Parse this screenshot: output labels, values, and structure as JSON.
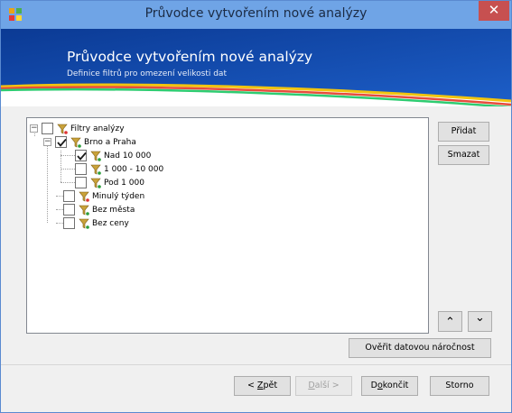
{
  "window": {
    "title": "Průvodce vytvořením nové analýzy",
    "close_glyph": "✕",
    "titlebar_color": "#6fa4e6",
    "close_color": "#c75050"
  },
  "banner": {
    "title": "Průvodce vytvořením nové analýzy",
    "subtitle": "Definice filtrů pro omezení velikosti dat",
    "background": "#0a3d9e"
  },
  "tree": {
    "root": {
      "label": "Filtry analýzy",
      "checked": false,
      "expanded": true
    },
    "brno": {
      "label": "Brno a Praha",
      "checked": true,
      "expanded": true
    },
    "nad": {
      "label": "Nad 10 000",
      "checked": true
    },
    "range": {
      "label": "1 000 - 10 000",
      "checked": false
    },
    "pod": {
      "label": "Pod 1 000",
      "checked": false
    },
    "tyden": {
      "label": "Minulý týden",
      "checked": false
    },
    "mesto": {
      "label": "Bez města",
      "checked": false
    },
    "ceny": {
      "label": "Bez ceny",
      "checked": false
    },
    "expander_glyph": "−"
  },
  "side_buttons": {
    "add": "Přidat",
    "delete": "Smazat",
    "up_glyph": "⌃",
    "down_glyph": "⌄"
  },
  "verify_button": "Ověřit datovou náročnost",
  "footer": {
    "back": {
      "hotkey": "Z",
      "rest": "pět",
      "prefix": "< "
    },
    "next": {
      "hotkey": "D",
      "rest": "alší",
      "suffix": " >"
    },
    "finish": {
      "hotkey": "o",
      "rest_before": "D",
      "rest_after": "končit"
    },
    "cancel": "Storno"
  }
}
